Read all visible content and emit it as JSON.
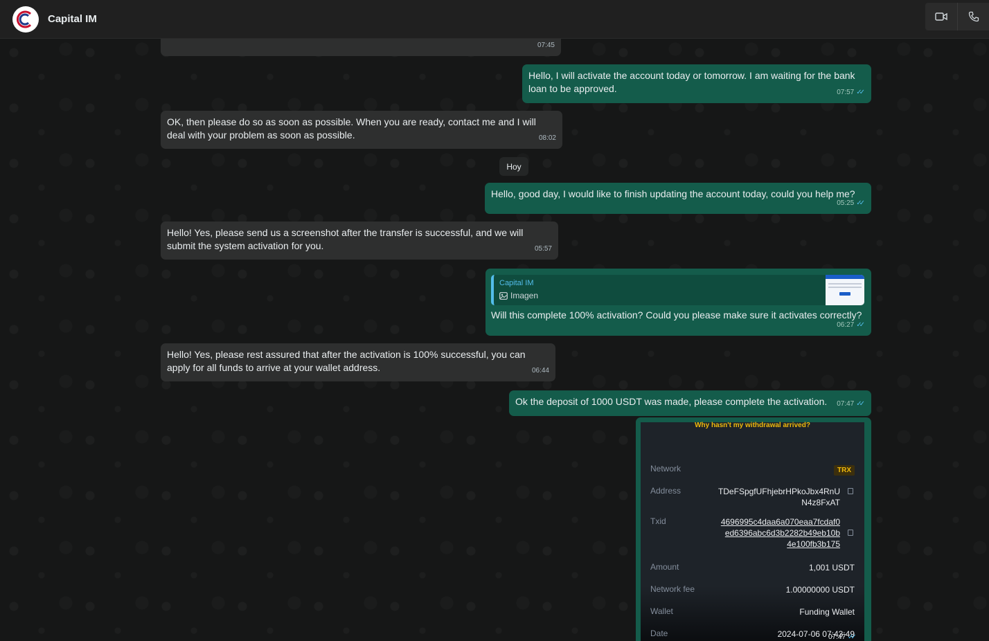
{
  "header": {
    "contact_name": "Capital IM",
    "icons": [
      "video-call-icon",
      "phone-call-icon"
    ]
  },
  "colors": {
    "incoming_bubble": "#2e2f2f",
    "outgoing_bubble": "#145c4b",
    "read_tick": "#53bdeb",
    "header_bg": "#202020"
  },
  "messages": [
    {
      "direction": "in",
      "text": "",
      "time": "07:45"
    },
    {
      "direction": "out",
      "text": "Hello, I will activate the account today or tomorrow. I am waiting for the bank loan to be approved.",
      "time": "07:57"
    },
    {
      "direction": "in",
      "text": "OK, then please do so as soon as possible. When you are ready, contact me and I will deal with your problem as soon as possible.",
      "time": "08:02"
    },
    {
      "direction": "out",
      "text": "Hello, good day, I would like to finish updating the account today, could you help me?",
      "time": "05:25"
    },
    {
      "direction": "in",
      "text": "Hello! Yes, please send us a screenshot after the transfer is successful, and we will submit the system activation for you.",
      "time": "05:57"
    },
    {
      "direction": "out",
      "text": "Will this complete 100% activation? Could you please make sure it activates correctly?",
      "time": "06:27",
      "quote": {
        "name": "Capital IM",
        "text": "Imagen"
      }
    },
    {
      "direction": "in",
      "text": "Hello! Yes, please rest assured that after the activation is 100% successful, you can apply for all funds to arrive at your wallet address.",
      "time": "06:44"
    },
    {
      "direction": "out",
      "text": "Ok the deposit of 1000 USDT was made, please complete the activation.",
      "time": "07:47"
    },
    {
      "direction": "out",
      "text": "",
      "time": "07:47"
    }
  ],
  "day_separator": "Hoy",
  "receipt": {
    "title": "Why hasn't my withdrawal arrived?",
    "network_label": "Network",
    "network_value": "TRX",
    "address_label": "Address",
    "address_value_1": "TDeFSpgfUFhjebrHPkoJbx4RnU",
    "address_value_2": "N4z8FxAT",
    "txid_label": "Txid",
    "txid_value_1": "4696995c4daa6a070eaa7fcdaf0",
    "txid_value_2": "ed6396abc6d3b2282b49eb10b",
    "txid_value_3": "4e100fb3b175",
    "amount_label": "Amount",
    "amount_value": "1,001 USDT",
    "fee_label": "Network fee",
    "fee_value": "1.00000000 USDT",
    "wallet_label": "Wallet",
    "wallet_value": "Funding Wallet",
    "date_label": "Date",
    "date_value": "2024-07-06 07:43:49"
  }
}
